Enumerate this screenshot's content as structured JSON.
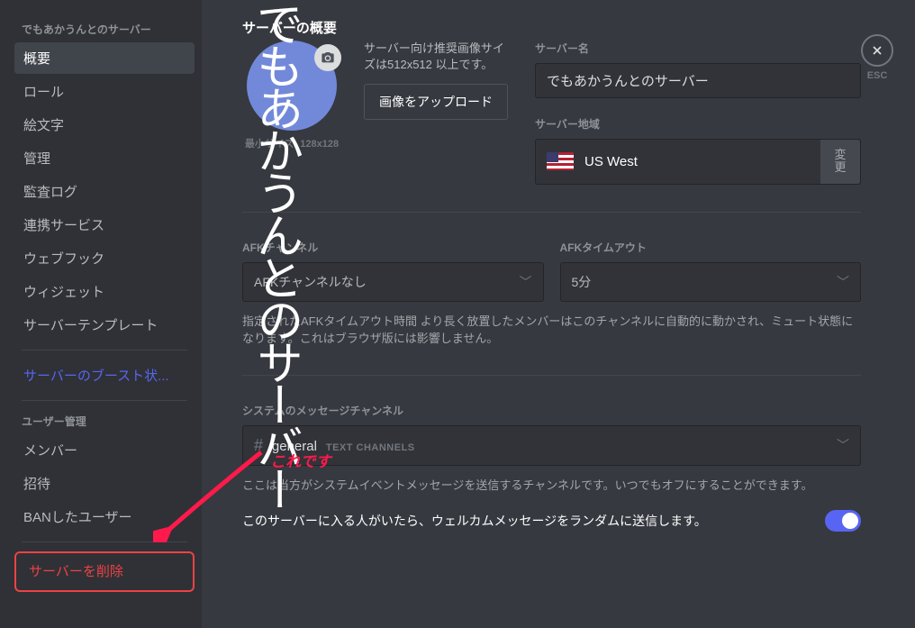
{
  "sidebar": {
    "header": "でもあかうんとのサーバー",
    "items": {
      "overview": "概要",
      "roles": "ロール",
      "emoji": "絵文字",
      "moderation": "管理",
      "audit": "監査ログ",
      "integrations": "連携サービス",
      "webhooks": "ウェブフック",
      "widget": "ウィジェット",
      "template": "サーバーテンプレート",
      "boost": "サーバーのブースト状...",
      "user_header": "ユーザー管理",
      "members": "メンバー",
      "invites": "招待",
      "bans": "BANしたユーザー",
      "delete": "サーバーを削除"
    }
  },
  "page_title": "サーバーの概要",
  "server_icon_initial": "で",
  "big_overlay_text": "でもあかうんとのサーバー",
  "min_size": "最小サイズ: 128x128",
  "image_hint": "サーバー向け推奨画像サイズは512x512 以上です。",
  "upload_btn": "画像をアップロード",
  "name_label": "サーバー名",
  "server_name": "でもあかうんとのサーバー",
  "region_label": "サーバー地域",
  "region_value": "US West",
  "change_label": "変更",
  "afk_channel_label": "AFKチャンネル",
  "afk_channel_value": "AFKチャンネルなし",
  "afk_timeout_label": "AFKタイムアウト",
  "afk_timeout_value": "5分",
  "afk_desc": "指定されたAFKタイムアウト時間 より長く放置したメンバーはこのチャンネルに自動的に動かされ、ミュート状態になります。これはブラウザ版には影響しません。",
  "sys_label": "システムのメッセージチャンネル",
  "sys_channel_name": "general",
  "sys_channel_cat": "TEXT CHANNELS",
  "sys_desc": "ここは当方がシステムイベントメッセージを送信するチャンネルです。いつでもオフにすることができます。",
  "welcome_toggle": "このサーバーに入る人がいたら、ウェルカムメッセージをランダムに送信します。",
  "esc": "ESC",
  "annotation": "これです"
}
